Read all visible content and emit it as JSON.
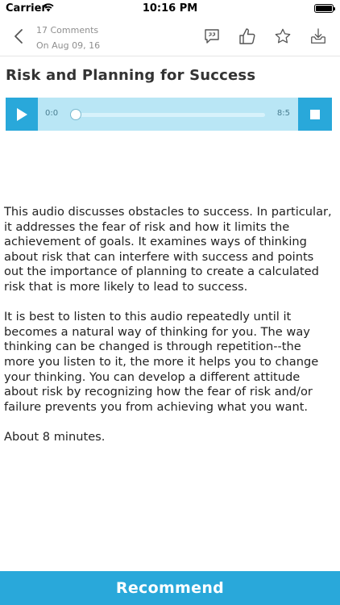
{
  "status_bar": {
    "carrier": "Carrier",
    "time": "10:16 PM"
  },
  "header": {
    "comments": "17 Comments",
    "date": "On Aug 09, 16",
    "icons": [
      "back-chevron-icon",
      "comments-icon",
      "thumbs-up-icon",
      "star-icon",
      "download-icon"
    ]
  },
  "article": {
    "title": "Risk and Planning for Success",
    "paragraphs": [
      "This audio discusses obstacles to success. In particular, it addresses the fear of risk and how it limits the achievement of goals. It examines ways of thinking about risk that can interfere with success and points out the importance of planning to create a calculated risk that is more likely to lead to success.",
      "It is best to listen to this audio repeatedly until it becomes a natural way of thinking for you. The way thinking can be changed is through repetition--the more you listen to it, the more it helps you to change your thinking. You can develop a different attitude about risk by recognizing how the fear of risk and/or failure prevents you from achieving what you want.",
      "About 8 minutes."
    ]
  },
  "player": {
    "current_time": "0:0",
    "duration": "8:5",
    "progress": 0
  },
  "footer": {
    "recommend_label": "Recommend"
  },
  "colors": {
    "accent": "#29a8da",
    "player_bg": "#b9e6f5"
  }
}
